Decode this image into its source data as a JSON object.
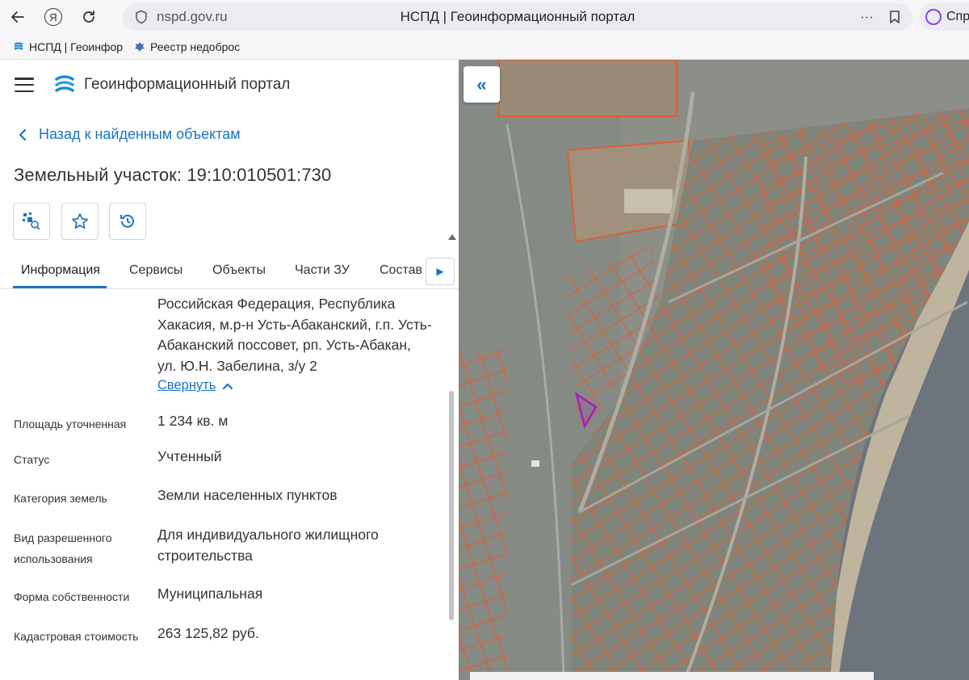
{
  "browser": {
    "url": "nspd.gov.ru",
    "tab_title": "НСПД | Геоинформационный портал",
    "ya_label": "Я",
    "alice_label": "Спр",
    "bookmarks": [
      {
        "label": "НСПД | Геоинфор"
      },
      {
        "label": "Реестр недоброс"
      }
    ]
  },
  "app": {
    "title": "Геоинформационный портал"
  },
  "back_link": "Назад к найденным объектам",
  "object_title": "Земельный участок: 19:10:010501:730",
  "tabs": [
    {
      "label": "Информация",
      "active": true
    },
    {
      "label": "Сервисы"
    },
    {
      "label": "Объекты"
    },
    {
      "label": "Части ЗУ"
    },
    {
      "label": "Состав"
    }
  ],
  "info": {
    "address": "Российская Федерация, Республика Хакасия, м.р-н Усть-Абаканский, г.п. Усть-Абаканский поссовет, рп. Усть-Абакан, ул. Ю.Н. Забелина, з/у 2",
    "collapse_label": "Свернуть",
    "rows": [
      {
        "label": "Площадь уточненная",
        "value": "1 234 кв. м"
      },
      {
        "label": "Статус",
        "value": "Учтенный"
      },
      {
        "label": "Категория земель",
        "value": "Земли населенных пунктов"
      },
      {
        "label": "Вид разрешенного использования",
        "value": "Для индивидуального жилищного строительства"
      },
      {
        "label": "Форма собственности",
        "value": "Муниципальная"
      },
      {
        "label": "Кадастровая стоимость",
        "value": "263 125,82 руб."
      }
    ]
  },
  "colors": {
    "accent": "#1a73c4",
    "parcel_outline": "#e0562f",
    "selected_parcel": "#a020c0"
  }
}
